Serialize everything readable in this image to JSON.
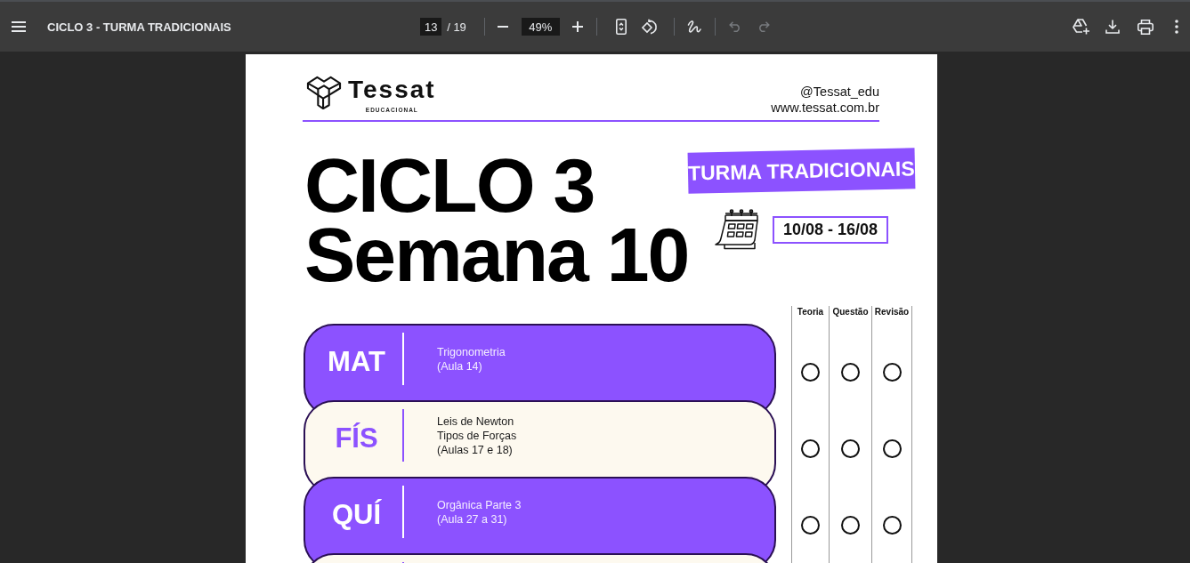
{
  "toolbar": {
    "title": "CICLO 3 - TURMA TRADICIONAIS",
    "page_number": "13",
    "page_count": "/ 19",
    "zoom": "49%",
    "undo": {
      "disabled": true
    },
    "redo": {
      "disabled": true
    }
  },
  "page": {
    "logo": {
      "wordmark": "Tessat",
      "tagline": "EDUCACIONAL"
    },
    "handle": "@Tessat_edu",
    "website": "www.tessat.com.br",
    "title": [
      "CICLO 3",
      "Semana 10"
    ],
    "banner": "TURMA TRADICIONAIS",
    "date_range": "10/08 - 16/08",
    "subjects": [
      {
        "abbreviation": "MAT",
        "lines": [
          "Trigonometria",
          "(Aula 14)"
        ],
        "color": "#8c52ff"
      },
      {
        "abbreviation": "FÍS",
        "lines": [
          "Leis de Newton",
          "Tipos de Forças",
          "(Aulas 17 e 18)"
        ],
        "color": "#fdf9ef"
      },
      {
        "abbreviation": "QUÍ",
        "lines": [
          "Orgânica Parte 3",
          "(Aula 27 a 31)"
        ],
        "color": "#8c52ff"
      },
      {
        "color": "#fdf9ef"
      }
    ],
    "checklist": {
      "columns": [
        "Teoria",
        "Questão",
        "Revisão"
      ],
      "rows": [
        {
          "boxes": [
            {
              "checked": false
            },
            {
              "checked": false
            },
            {
              "checked": false
            }
          ]
        },
        {
          "boxes": [
            {
              "checked": false
            },
            {
              "checked": false
            },
            {
              "checked": false
            }
          ]
        },
        {
          "boxes": [
            {
              "checked": false
            },
            {
              "checked": false
            },
            {
              "checked": false
            }
          ]
        }
      ]
    }
  }
}
